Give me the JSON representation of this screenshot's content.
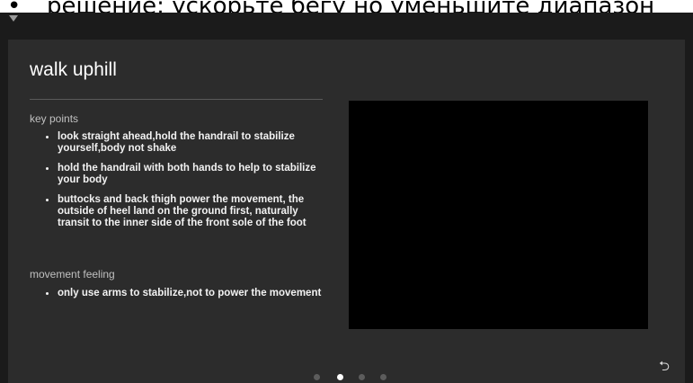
{
  "caption": {
    "bullet": "•",
    "text": "решение: ускорьте бегу но уменьшите диапазон"
  },
  "status_bar": {
    "wifi_icon": "wifi-icon"
  },
  "exercise": {
    "title": "walk uphill",
    "key_points_label": "key points",
    "key_points": [
      "look straight ahead,hold the handrail to stabilize yourself,body not shake",
      "hold the handrail with both hands to help to stabilize your body",
      "buttocks and back thigh power the movement, the outside of heel land on the ground first, naturally transit to the inner side of the front sole of the foot"
    ],
    "feeling_label": "movement feeling",
    "feeling_points": [
      "only use arms to stabilize,not to power the movement"
    ]
  },
  "pager": {
    "total": 4,
    "active_index": 1
  },
  "nav": {
    "back_icon_name": "back-arrow-icon",
    "back_glyph": "⮌"
  },
  "colors": {
    "screen_bg": "#2c2c2c",
    "outer_bg": "#1b1b1b",
    "video_bg": "#000000",
    "text": "#f2f2f2",
    "muted": "#c0c0c0"
  }
}
